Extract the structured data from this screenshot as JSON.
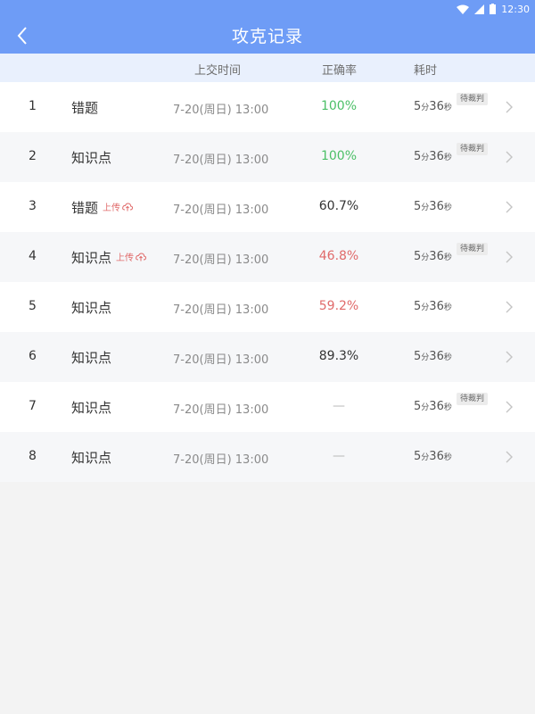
{
  "status": {
    "time": "12:30"
  },
  "header": {
    "title": "攻克记录",
    "back_icon": "chevron-left-icon"
  },
  "columns": {
    "submit_time": "上交时间",
    "accuracy": "正确率",
    "duration": "耗时"
  },
  "upload_label": "上传",
  "pending_label": "待裁判",
  "colors": {
    "primary": "#6e9cf6",
    "green": "#4bbf66",
    "red": "#e06a6a"
  },
  "rows": [
    {
      "index": "1",
      "name": "错题",
      "upload": false,
      "time": "7-20(周日) 13:00",
      "accuracy": "100%",
      "accuracy_style": "green",
      "dur_min": "5",
      "min_unit": "分",
      "dur_sec": "36",
      "sec_unit": "秒",
      "pending": true
    },
    {
      "index": "2",
      "name": "知识点",
      "upload": false,
      "time": "7-20(周日) 13:00",
      "accuracy": "100%",
      "accuracy_style": "green",
      "dur_min": "5",
      "min_unit": "分",
      "dur_sec": "36",
      "sec_unit": "秒",
      "pending": true
    },
    {
      "index": "3",
      "name": "错题",
      "upload": true,
      "time": "7-20(周日) 13:00",
      "accuracy": "60.7%",
      "accuracy_style": "normal",
      "dur_min": "5",
      "min_unit": "分",
      "dur_sec": "36",
      "sec_unit": "秒",
      "pending": false
    },
    {
      "index": "4",
      "name": "知识点",
      "upload": true,
      "time": "7-20(周日) 13:00",
      "accuracy": "46.8%",
      "accuracy_style": "red",
      "dur_min": "5",
      "min_unit": "分",
      "dur_sec": "36",
      "sec_unit": "秒",
      "pending": true
    },
    {
      "index": "5",
      "name": "知识点",
      "upload": false,
      "time": "7-20(周日) 13:00",
      "accuracy": "59.2%",
      "accuracy_style": "red",
      "dur_min": "5",
      "min_unit": "分",
      "dur_sec": "36",
      "sec_unit": "秒",
      "pending": false
    },
    {
      "index": "6",
      "name": "知识点",
      "upload": false,
      "time": "7-20(周日) 13:00",
      "accuracy": "89.3%",
      "accuracy_style": "normal",
      "dur_min": "5",
      "min_unit": "分",
      "dur_sec": "36",
      "sec_unit": "秒",
      "pending": false
    },
    {
      "index": "7",
      "name": "知识点",
      "upload": false,
      "time": "7-20(周日) 13:00",
      "accuracy": "—",
      "accuracy_style": "dash",
      "dur_min": "5",
      "min_unit": "分",
      "dur_sec": "36",
      "sec_unit": "秒",
      "pending": true
    },
    {
      "index": "8",
      "name": "知识点",
      "upload": false,
      "time": "7-20(周日) 13:00",
      "accuracy": "—",
      "accuracy_style": "dash",
      "dur_min": "5",
      "min_unit": "分",
      "dur_sec": "36",
      "sec_unit": "秒",
      "pending": false
    }
  ]
}
